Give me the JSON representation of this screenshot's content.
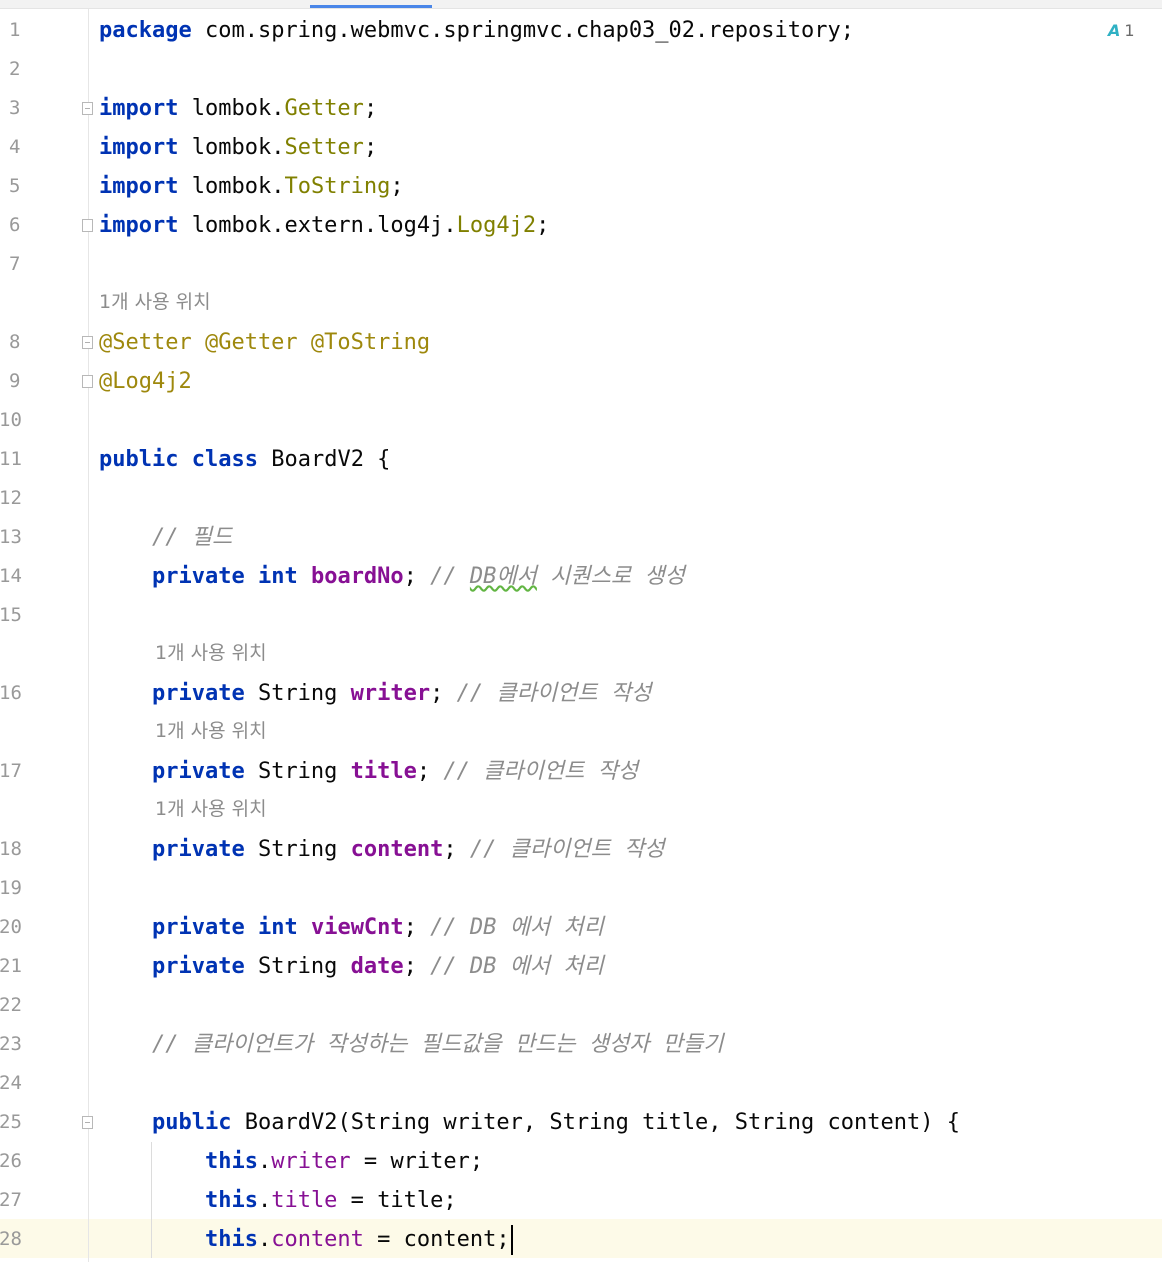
{
  "editor": {
    "inspection_count": "1",
    "usage_hint": "1개 사용 위치",
    "package_path": "com.spring.webmvc.springmvc.chap03_02.repository",
    "imports": [
      {
        "pkg": "lombok.",
        "cls": "Getter"
      },
      {
        "pkg": "lombok.",
        "cls": "Setter"
      },
      {
        "pkg": "lombok.",
        "cls": "ToString"
      },
      {
        "pkg": "lombok.extern.log4j.",
        "cls": "Log4j2"
      }
    ],
    "annotations_line": "@Setter @Getter @ToString",
    "annotation_log": "@Log4j2",
    "class_name": "BoardV2",
    "comment_fields": "// 필드",
    "comment_seq_prefix": "// ",
    "comment_seq_db": "DB에서",
    "comment_seq_rest": " 시퀀스로 생성",
    "comment_client": "// 클라이언트 작성",
    "comment_db": "// DB 에서 처리",
    "comment_ctor": "// 클라이언트가 작성하는 필드값을 만드는 생성자 만들기",
    "field_boardNo": "boardNo",
    "field_writer": "writer",
    "field_title": "title",
    "field_content": "content",
    "field_viewCnt": "viewCnt",
    "field_date": "date",
    "ctor_params": "String writer, String title, String content",
    "line_numbers": [
      "1",
      "2",
      "3",
      "4",
      "5",
      "6",
      "7",
      "8",
      "9",
      "10",
      "11",
      "12",
      "13",
      "14",
      "15",
      "16",
      "17",
      "18",
      "19",
      "20",
      "21",
      "22",
      "23",
      "24",
      "25",
      "26",
      "27",
      "28"
    ]
  }
}
